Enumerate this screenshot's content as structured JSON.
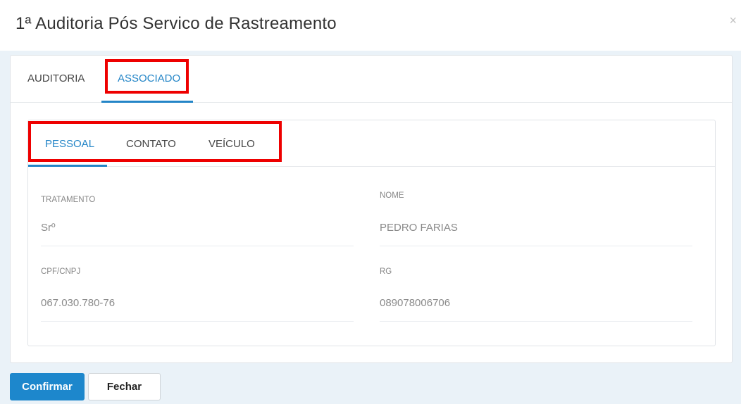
{
  "modal": {
    "title": "1ª Auditoria Pós Servico de Rastreamento",
    "close_symbol": "×"
  },
  "outer_tabs": [
    {
      "label": "AUDITORIA",
      "active": false
    },
    {
      "label": "ASSOCIADO",
      "active": true
    }
  ],
  "inner_tabs": [
    {
      "label": "PESSOAL",
      "active": true
    },
    {
      "label": "CONTATO",
      "active": false
    },
    {
      "label": "VEÍCULO",
      "active": false
    }
  ],
  "fields": {
    "tratamento": {
      "label": "TRATAMENTO",
      "value": "Srº"
    },
    "nome": {
      "label": "NOME",
      "value": "PEDRO FARIAS"
    },
    "cpf": {
      "label": "CPF/CNPJ",
      "value": "067.030.780-76"
    },
    "rg": {
      "label": "RG",
      "value": "089078006706"
    }
  },
  "footer": {
    "confirm_label": "Confirmar",
    "close_label": "Fechar"
  },
  "colors": {
    "accent": "#2385c7",
    "highlight": "#ee0000",
    "background": "#eaf2f8"
  }
}
